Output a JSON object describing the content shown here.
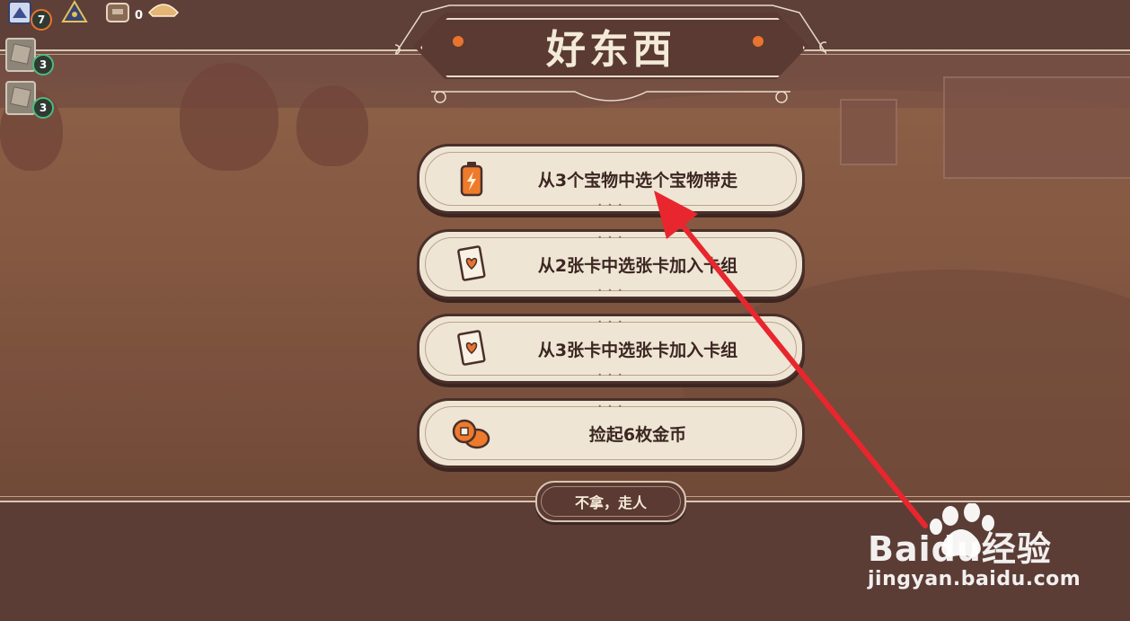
{
  "screen": {
    "title": "好东西",
    "options": [
      {
        "label": "从3个宝物中选个宝物带走",
        "icon": "battery-relic-icon"
      },
      {
        "label": "从2张卡中选张卡加入卡组",
        "icon": "heart-card-icon"
      },
      {
        "label": "从3张卡中选张卡加入卡组",
        "icon": "heart-card-icon"
      },
      {
        "label": "捡起6枚金币",
        "icon": "gold-coins-icon"
      }
    ],
    "leave_label": "不拿，走人"
  },
  "hud": {
    "deck_count": "7",
    "gold": "0",
    "relic_counts": [
      "3",
      "3"
    ]
  },
  "watermark": {
    "brand_text": "Baidu经验",
    "url": "jingyan.baidu.com"
  },
  "colors": {
    "accent": "#e8742f",
    "banner": "#5a3a32",
    "option_bg": "#efe5d4",
    "arrow": "#e8262e"
  }
}
